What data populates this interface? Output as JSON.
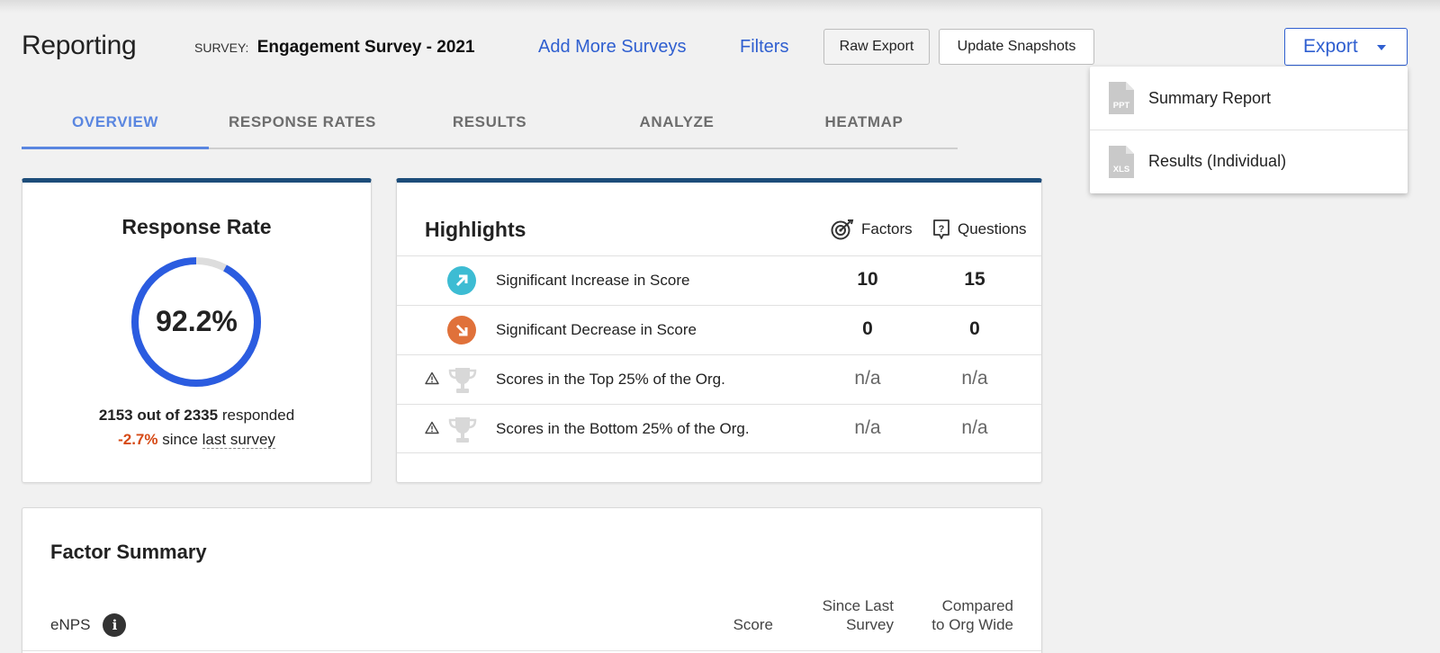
{
  "header": {
    "app_title": "Reporting",
    "survey_prefix": "SURVEY:",
    "survey_name": "Engagement Survey - 2021",
    "add_more_surveys": "Add More Surveys",
    "filters": "Filters",
    "raw_export": "Raw Export",
    "update_snapshots": "Update Snapshots",
    "export": "Export"
  },
  "export_menu": {
    "items": [
      {
        "label": "Summary Report",
        "icon": "ppt-file-icon",
        "badge": "PPT"
      },
      {
        "label": "Results (Individual)",
        "icon": "xls-file-icon",
        "badge": "XLS"
      }
    ]
  },
  "tabs": [
    {
      "label": "OVERVIEW",
      "active": true
    },
    {
      "label": "RESPONSE RATES",
      "active": false
    },
    {
      "label": "RESULTS",
      "active": false
    },
    {
      "label": "ANALYZE",
      "active": false
    },
    {
      "label": "HEATMAP",
      "active": false
    }
  ],
  "response_rate": {
    "title": "Response Rate",
    "value_text": "92.2%",
    "value": 0.922,
    "responded_strong": "2153 out of 2335",
    "responded_rest": "responded",
    "change": "-2.7%",
    "since": "since",
    "last_survey": "last survey",
    "colors": {
      "ring": "#2b5ce0",
      "track": "#dddddd",
      "negative": "#d64a16"
    }
  },
  "highlights": {
    "title": "Highlights",
    "col_factors": "Factors",
    "col_questions": "Questions",
    "rows": [
      {
        "label": "Significant Increase in Score",
        "factors": "10",
        "questions": "15",
        "icon": "arrow-up-right-icon",
        "color": "#3dbcd3"
      },
      {
        "label": "Significant Decrease in Score",
        "factors": "0",
        "questions": "0",
        "icon": "arrow-down-right-icon",
        "color": "#e0713a"
      },
      {
        "label": "Scores in the Top 25% of the Org.",
        "factors": "n/a",
        "questions": "n/a",
        "icon": "trophy-icon"
      },
      {
        "label": "Scores in the Bottom 25% of the Org.",
        "factors": "n/a",
        "questions": "n/a",
        "icon": "trophy-icon"
      }
    ]
  },
  "factor_summary": {
    "title": "Factor Summary",
    "enps_label": "eNPS",
    "info_glyph": "i",
    "col_score": "Score",
    "col_since_1": "Since Last",
    "col_since_2": "Survey",
    "col_compared_1": "Compared",
    "col_compared_2": "to Org Wide"
  }
}
